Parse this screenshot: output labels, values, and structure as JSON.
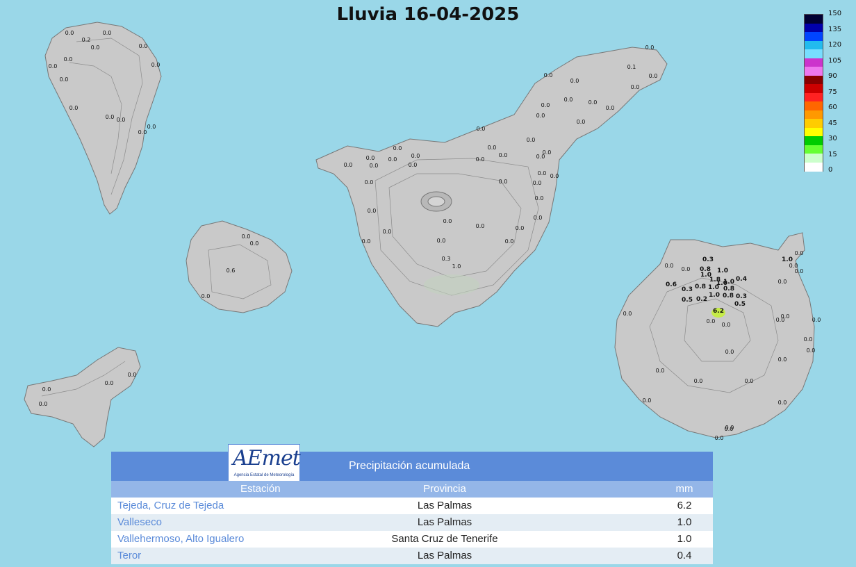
{
  "title": "Lluvia 16-04-2025",
  "legend": {
    "ticks": [
      "150",
      "135",
      "120",
      "105",
      "90",
      "75",
      "60",
      "45",
      "30",
      "15",
      "0"
    ],
    "colors": [
      "#000033",
      "#0000aa",
      "#0044ff",
      "#22bbee",
      "#77ddff",
      "#cc33cc",
      "#ee77ee",
      "#880000",
      "#cc0000",
      "#ff2222",
      "#ff6600",
      "#ff9900",
      "#ffcc00",
      "#ffff00",
      "#00cc00",
      "#66ff33",
      "#ccffcc",
      "#ffffff"
    ]
  },
  "islands": {
    "la_palma": [
      "0.0",
      "0.0",
      "0.2",
      "0.0",
      "0.0",
      "0.0",
      "0.0",
      "0.0",
      "0.0",
      "0.0",
      "0.0",
      "0.0",
      "0.0",
      "0.0"
    ],
    "la_gomera": [
      "0.0",
      "0.0",
      "0.6",
      "0.0"
    ],
    "el_hierro": [
      "0.0",
      "0.0",
      "0.0",
      "0.0"
    ],
    "tenerife": [
      "0.0",
      "0.1",
      "0.0",
      "0.0",
      "0.0",
      "0.0",
      "0.0",
      "0.0",
      "0.0",
      "0.0",
      "0.0",
      "0.0",
      "0.0",
      "0.0",
      "0.0",
      "0.0",
      "0.0",
      "0.0",
      "0.0",
      "0.0",
      "0.0",
      "0.0",
      "0.0",
      "0.0",
      "0.0",
      "0.0",
      "0.0",
      "0.0",
      "0.0",
      "0.0",
      "0.0",
      "0.0",
      "0.0",
      "0.0",
      "0.0",
      "0.0",
      "0.0",
      "0.0",
      "0.3",
      "1.0",
      "0.0",
      "0.0",
      "0.0"
    ],
    "gran_canaria": [
      "0.3",
      "0.8",
      "1.0",
      "1.0",
      "1.0",
      "1.8",
      "1.0",
      "0.4",
      "0.6",
      "0.3",
      "0.8",
      "1.0",
      "0.8",
      "1.0",
      "0.8",
      "0.3",
      "0.5",
      "0.2",
      "0.5",
      "6.2",
      "1.0",
      "0.0",
      "0.0",
      "0.0",
      "0.0",
      "0.0",
      "0.0",
      "0.0",
      "0.0",
      "0.0",
      "0.0",
      "0.0",
      "0.0",
      "0.0",
      "0.0",
      "0.0",
      "0.0",
      "0.0",
      "0.0",
      "0.0",
      "0.0",
      "0.0",
      "0.0",
      "0.0",
      "0.0",
      "0.0"
    ]
  },
  "table": {
    "logo": "AEmet",
    "logo_sub": "Agencia Estatal de Meteorología",
    "header": "Precipitación acumulada",
    "columns": [
      "Estación",
      "Provincia",
      "mm"
    ],
    "rows": [
      {
        "station": "Tejeda, Cruz de Tejeda",
        "province": "Las Palmas",
        "mm": "6.2"
      },
      {
        "station": "Valleseco",
        "province": "Las Palmas",
        "mm": "1.0"
      },
      {
        "station": "Vallehermoso, Alto Igualero",
        "province": "Santa Cruz de Tenerife",
        "mm": "1.0"
      },
      {
        "station": "Teror",
        "province": "Las Palmas",
        "mm": "0.4"
      }
    ]
  }
}
